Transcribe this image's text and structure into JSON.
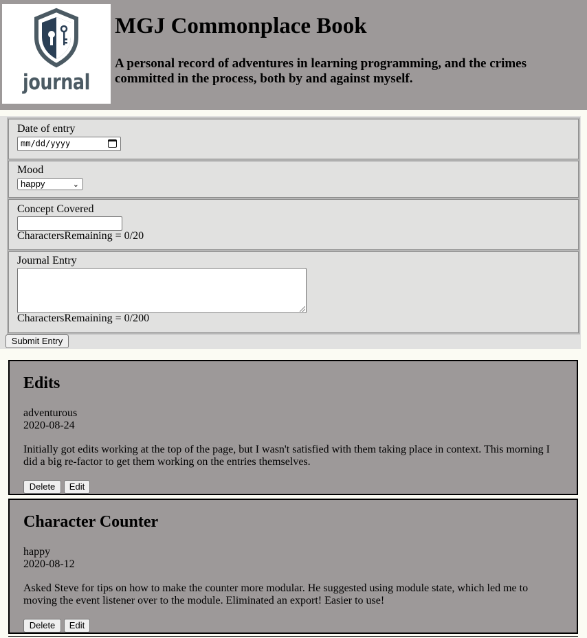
{
  "header": {
    "logo_text": "journal",
    "title": "MGJ Commonplace Book",
    "subtitle": "A personal record of adventures in learning programming, and the crimes committed in the process, both by and against myself."
  },
  "form": {
    "date_label": "Date of entry",
    "date_placeholder": "mm/dd/yyyy",
    "mood_label": "Mood",
    "mood_selected": "happy",
    "concept_label": "Concept Covered",
    "concept_value": "",
    "concept_counter": "CharactersRemaining = 0/20",
    "entry_label": "Journal Entry",
    "entry_value": "",
    "entry_counter": "CharactersRemaining = 0/200",
    "submit_label": "Submit Entry"
  },
  "entries": [
    {
      "title": "Edits",
      "mood": "adventurous",
      "date": "2020-08-24",
      "text": "Initially got edits working at the top of the page, but I wasn't satisfied with them taking place in context. This morning I did a big re-factor to get them working on the entries themselves.",
      "delete_label": "Delete",
      "edit_label": "Edit"
    },
    {
      "title": "Character Counter",
      "mood": "happy",
      "date": "2020-08-12",
      "text": "Asked Steve for tips on how to make the counter more modular. He suggested using module state, which led me to moving the event listener over to the module. Eliminated an export! Easier to use!",
      "delete_label": "Delete",
      "edit_label": "Edit"
    }
  ],
  "colors": {
    "header_bg": "#9d9999",
    "form_bg": "#e1e1e0",
    "entry_bg": "#9d9999",
    "logo_color": "#4b5a63"
  },
  "icons": {
    "logo": "shield-keyhole-icon",
    "calendar": "calendar-icon",
    "dropdown": "chevron-down-icon"
  }
}
